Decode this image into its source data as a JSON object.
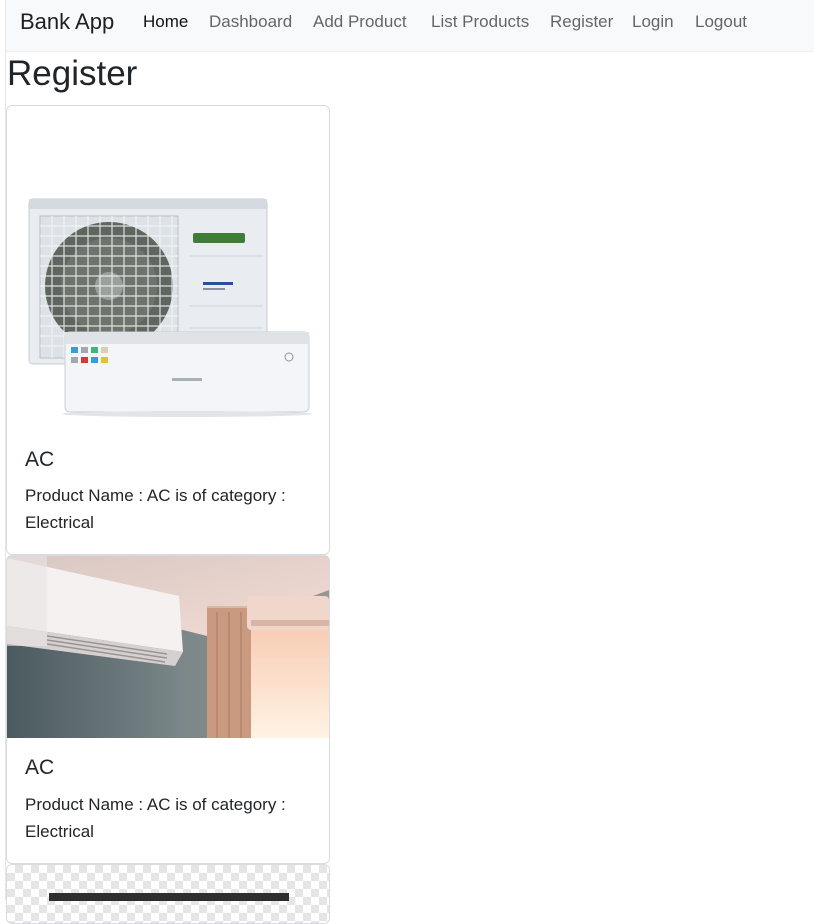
{
  "navbar": {
    "brand": "Bank App",
    "links": [
      "Home",
      "Dashboard",
      "Add Product",
      "List Products",
      "Register",
      "Login",
      "Logout"
    ],
    "active_index": 0
  },
  "page": {
    "title": "Register"
  },
  "products": [
    {
      "title": "AC",
      "text_line1": "Product Name : AC is of category :",
      "text_line2": "Electrical",
      "image": "outdoor-ac-unit-photo"
    },
    {
      "title": "AC",
      "text_line1": "Product Name : AC is of category :",
      "text_line2": "Electrical",
      "image": "wall-mounted-ac-room-photo"
    },
    {
      "image": "transparent-background-product-photo"
    }
  ],
  "colors": {
    "navbar_bg": "#f8f9fa",
    "card_border": "#d8dbdf",
    "text": "#212529"
  }
}
